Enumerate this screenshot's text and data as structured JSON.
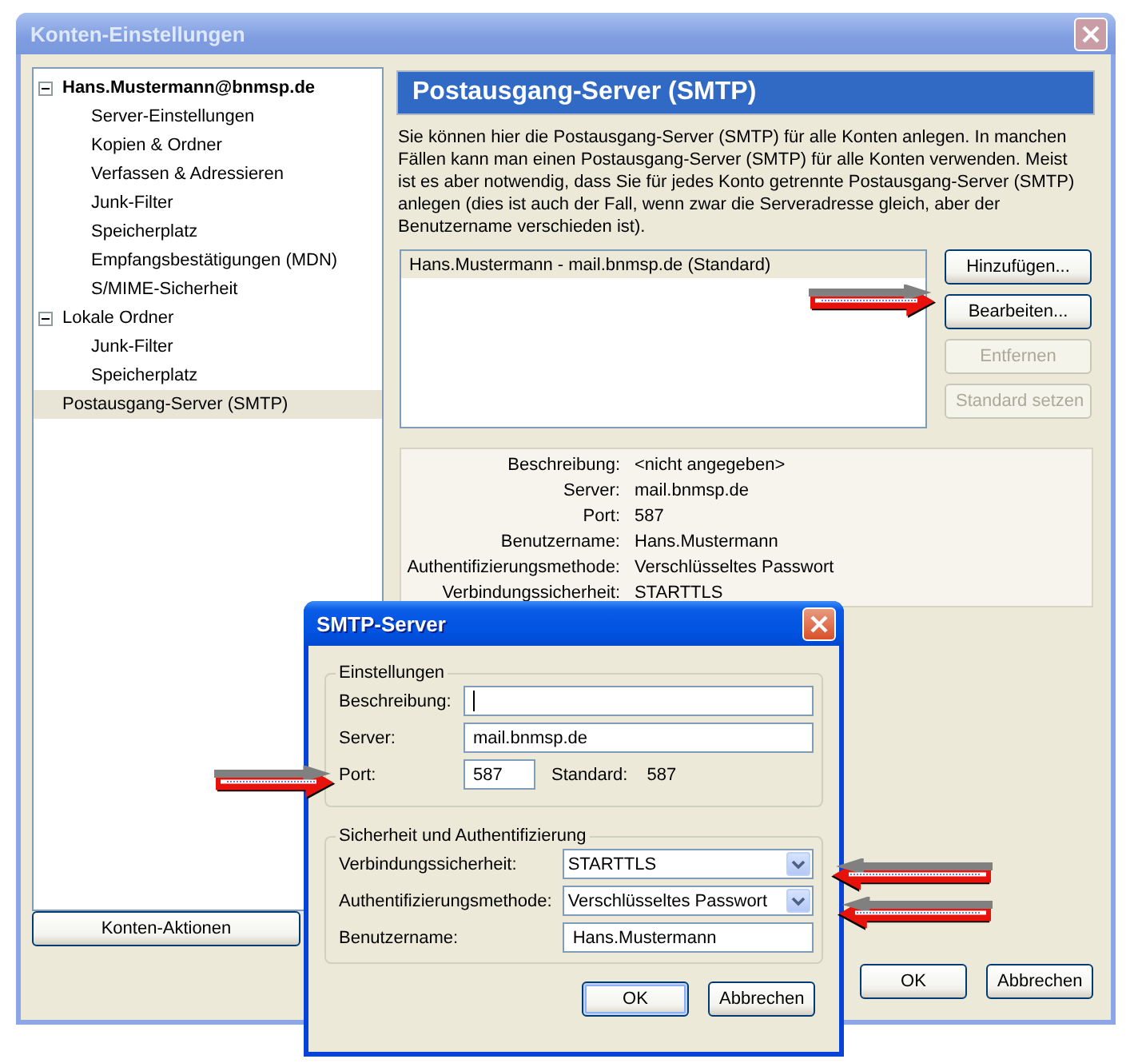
{
  "window": {
    "title": "Konten-Einstellungen"
  },
  "tree": [
    {
      "label": "Hans.Mustermann@bnmsp.de",
      "bold": true,
      "expanded": true,
      "selected": false,
      "children": [
        {
          "label": "Server-Einstellungen",
          "selected": false
        },
        {
          "label": "Kopien & Ordner",
          "selected": false
        },
        {
          "label": "Verfassen & Adressieren",
          "selected": false
        },
        {
          "label": "Junk-Filter",
          "selected": false
        },
        {
          "label": "Speicherplatz",
          "selected": false
        },
        {
          "label": "Empfangsbestätigungen (MDN)",
          "selected": false
        },
        {
          "label": "S/MIME-Sicherheit",
          "selected": false
        }
      ]
    },
    {
      "label": "Lokale Ordner",
      "bold": false,
      "expanded": true,
      "selected": false,
      "children": [
        {
          "label": "Junk-Filter",
          "selected": false
        },
        {
          "label": "Speicherplatz",
          "selected": false
        }
      ]
    },
    {
      "label": "Postausgang-Server (SMTP)",
      "bold": false,
      "selected": true
    }
  ],
  "account_actions": {
    "label": "Konten-Aktionen"
  },
  "panel": {
    "title": "Postausgang-Server (SMTP)",
    "description": "Sie können hier die Postausgang-Server (SMTP) für alle Konten anlegen. In manchen Fällen kann man einen Postausgang-Server (SMTP) für alle Konten verwenden. Meist ist es aber notwendig, dass Sie für jedes Konto getrennte Postausgang-Server (SMTP) anlegen (dies ist auch der Fall, wenn zwar die Serveradresse gleich, aber der Benutzername verschieden ist).",
    "servers": [
      {
        "label": "Hans.Mustermann - mail.bnmsp.de (Standard)",
        "selected": true
      }
    ],
    "buttons": [
      {
        "label": "Hinzufügen...",
        "disabled": false
      },
      {
        "label": "Bearbeiten...",
        "disabled": false
      },
      {
        "label": "Entfernen",
        "disabled": true
      },
      {
        "label": "Standard setzen",
        "disabled": true
      }
    ],
    "details": [
      {
        "label": "Beschreibung:",
        "value": "<nicht angegeben>"
      },
      {
        "label": "Server:",
        "value": "mail.bnmsp.de"
      },
      {
        "label": "Port:",
        "value": "587"
      },
      {
        "label": "Benutzername:",
        "value": "Hans.Mustermann"
      },
      {
        "label": "Authentifizierungsmethode:",
        "value": "Verschlüsseltes Passwort"
      },
      {
        "label": "Verbindungssicherheit:",
        "value": "STARTTLS"
      }
    ]
  },
  "buttons": [
    {
      "label": "OK"
    },
    {
      "label": "Abbrechen"
    }
  ],
  "dialog": {
    "title": "SMTP-Server",
    "groups": [
      {
        "title": "Einstellungen",
        "fields": [
          {
            "kind": "text",
            "label": "Beschreibung:",
            "focused": true
          },
          {
            "kind": "text",
            "label": "Server:",
            "value": "mail.bnmsp.de",
            "focused": false
          },
          {
            "kind": "port",
            "label": "Port:",
            "value": "587",
            "default_label": "Standard:",
            "default_value": "587",
            "focused": false
          }
        ]
      },
      {
        "title": "Sicherheit und Authentifizierung",
        "fields": [
          {
            "kind": "select",
            "label": "Verbindungssicherheit:",
            "value": "STARTTLS"
          },
          {
            "kind": "select",
            "label": "Authentifizierungsmethode:",
            "value": "Verschlüsseltes Passwort"
          },
          {
            "kind": "text",
            "label": "Benutzername:",
            "value": "Hans.Mustermann",
            "focused": false
          }
        ]
      }
    ],
    "buttons": [
      {
        "label": "OK",
        "default": true
      },
      {
        "label": "Abbrechen",
        "default": false
      }
    ]
  }
}
